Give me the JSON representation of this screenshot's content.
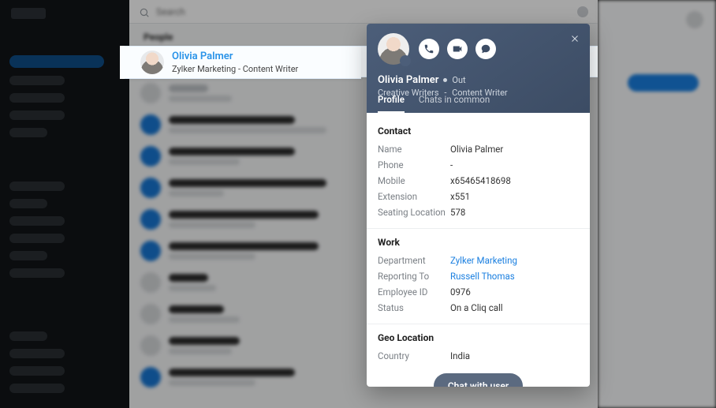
{
  "search": {
    "placeholder": "Search"
  },
  "section_label": "People",
  "selected": {
    "name": "Olivia  Palmer",
    "subtitle": "Zylker Marketing - Content Writer"
  },
  "profile": {
    "name": "Olivia  Palmer",
    "presence": "Out",
    "team": "Creative Writers",
    "role": "Content Writer",
    "tabs": {
      "profile": "Profile",
      "chats": "Chats in common"
    },
    "sections": {
      "contact": "Contact",
      "work": "Work",
      "geo": "Geo Location"
    },
    "contact": {
      "name_label": "Name",
      "name": "Olivia  Palmer",
      "phone_label": "Phone",
      "phone": "-",
      "mobile_label": "Mobile",
      "mobile": "x65465418698",
      "extension_label": "Extension",
      "extension": "x551",
      "seating_label": "Seating Location",
      "seating": "578"
    },
    "work": {
      "department_label": "Department",
      "department": "Zylker Marketing",
      "reporting_label": "Reporting To",
      "reporting": "Russell Thomas",
      "empid_label": "Employee ID",
      "empid": "0976",
      "status_label": "Status",
      "status": "On a Cliq call"
    },
    "geo": {
      "country_label": "Country",
      "country": "India"
    },
    "chat_button": "Chat with user"
  }
}
